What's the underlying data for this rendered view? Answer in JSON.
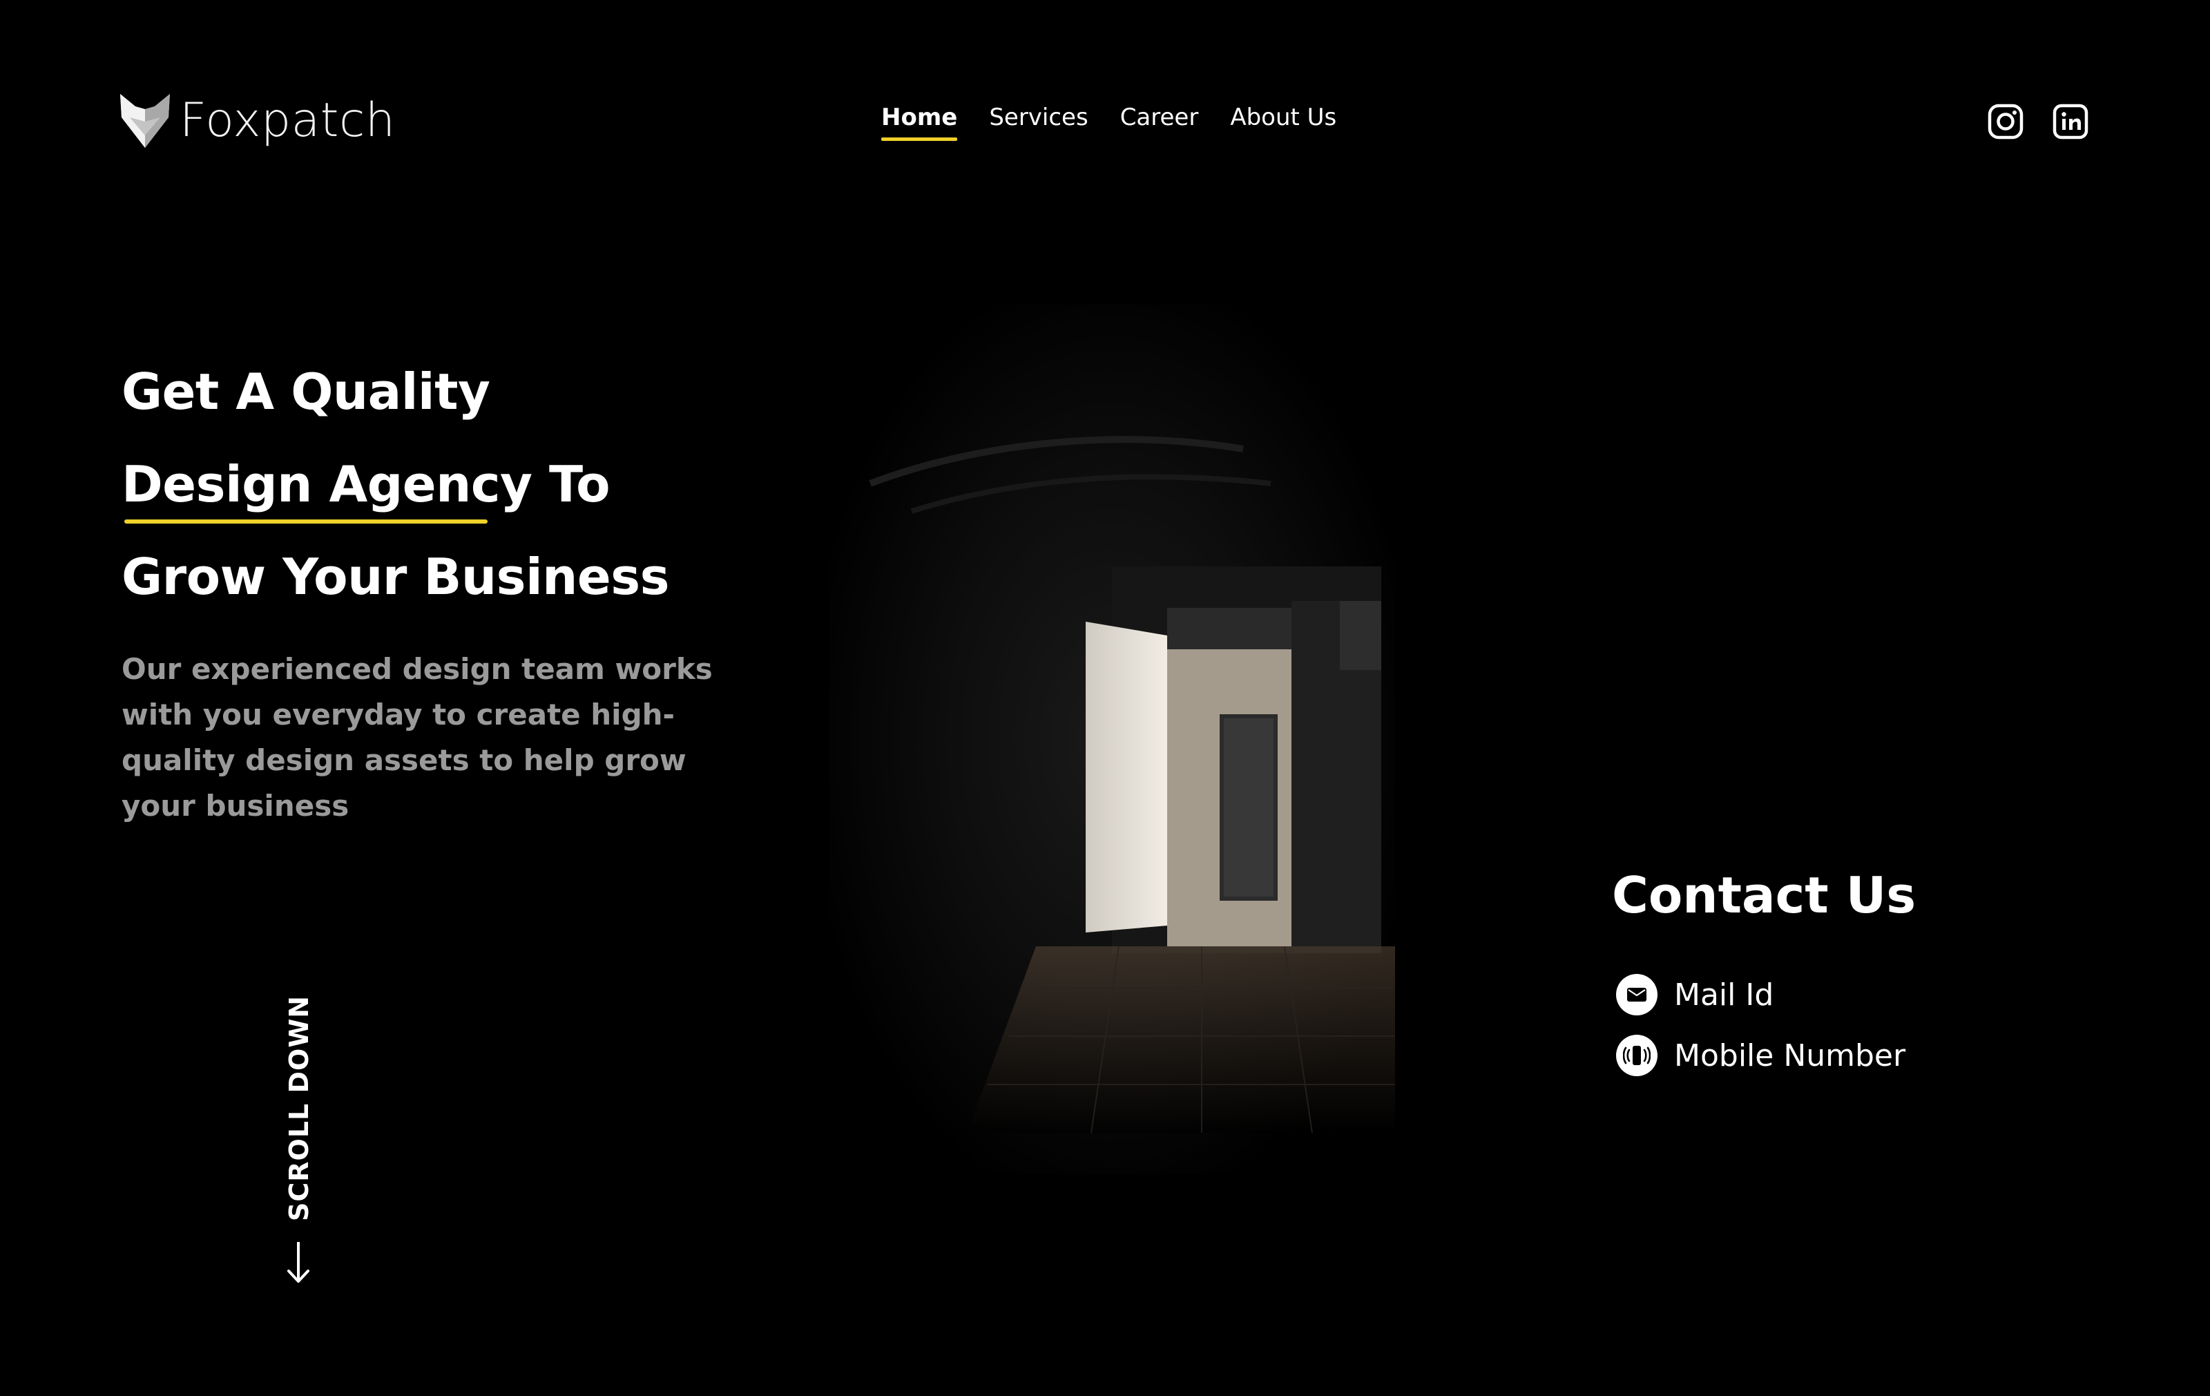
{
  "brand": {
    "name": "Foxpatch",
    "logo_icon": "fox-head-icon"
  },
  "nav": {
    "items": [
      {
        "label": "Home",
        "active": true
      },
      {
        "label": "Services",
        "active": false
      },
      {
        "label": "Career",
        "active": false
      },
      {
        "label": "About Us",
        "active": false
      }
    ]
  },
  "social": {
    "icons": [
      "instagram-icon",
      "linkedin-icon"
    ]
  },
  "hero": {
    "headline": [
      "Get A Quality",
      "Design Agency To",
      "Grow Your Business"
    ],
    "subtext": "Our experienced design team works with you everyday to create high-quality design assets to help grow your business",
    "image_icon": "dark-room-doorway-photo"
  },
  "scroll": {
    "label": "SCROLL DOWN",
    "icon": "arrow-down-icon"
  },
  "contact": {
    "title": "Contact Us",
    "mail_label": "Mail Id",
    "mail_icon": "mail-icon",
    "phone_label": "Mobile Number",
    "phone_icon": "phone-icon"
  },
  "colors": {
    "background": "#000000",
    "accent": "#f0d12a",
    "text": "#ffffff",
    "muted_text": "#9a9a9a"
  }
}
